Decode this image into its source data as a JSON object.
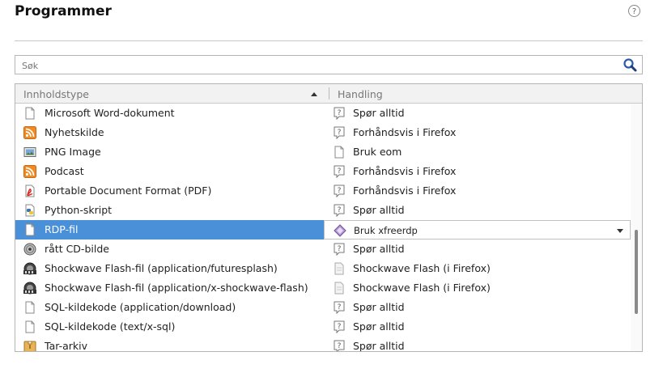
{
  "title": "Programmer",
  "help_glyph": "?",
  "search": {
    "placeholder": "Søk"
  },
  "table": {
    "col1": "Innholdstype",
    "col2": "Handling",
    "rows": [
      {
        "type": "Microsoft Word-dokument",
        "type_icon": "document-icon",
        "action": "Spør alltid",
        "action_icon": "ask-icon"
      },
      {
        "type": "Nyhetskilde",
        "type_icon": "rss-feed-icon",
        "action": "Forhåndsvis i Firefox",
        "action_icon": "ask-icon"
      },
      {
        "type": "PNG Image",
        "type_icon": "image-icon",
        "action": "Bruk eom",
        "action_icon": "document-icon"
      },
      {
        "type": "Podcast",
        "type_icon": "rss-feed-icon",
        "action": "Forhåndsvis i Firefox",
        "action_icon": "ask-icon"
      },
      {
        "type": "Portable Document Format (PDF)",
        "type_icon": "pdf-icon",
        "action": "Forhåndsvis i Firefox",
        "action_icon": "ask-icon"
      },
      {
        "type": "Python-skript",
        "type_icon": "python-icon",
        "action": "Spør alltid",
        "action_icon": "ask-icon"
      },
      {
        "type": "RDP-fil",
        "type_icon": "document-icon",
        "action": "Bruk xfreerdp",
        "action_icon": "xfreerdp-icon",
        "selected": true
      },
      {
        "type": "rått CD-bilde",
        "type_icon": "disc-icon",
        "action": "Spør alltid",
        "action_icon": "ask-icon"
      },
      {
        "type": "Shockwave Flash-fil (application/futuresplash)",
        "type_icon": "flash-film-icon",
        "action": "Shockwave Flash (i Firefox)",
        "action_icon": "plugin-icon"
      },
      {
        "type": "Shockwave Flash-fil (application/x-shockwave-flash)",
        "type_icon": "flash-film-icon",
        "action": "Shockwave Flash (i Firefox)",
        "action_icon": "plugin-icon"
      },
      {
        "type": "SQL-kildekode (application/download)",
        "type_icon": "document-icon",
        "action": "Spør alltid",
        "action_icon": "ask-icon"
      },
      {
        "type": "SQL-kildekode (text/x-sql)",
        "type_icon": "document-icon",
        "action": "Spør alltid",
        "action_icon": "ask-icon"
      },
      {
        "type": "Tar-arkiv",
        "type_icon": "archive-icon",
        "action": "Spør alltid",
        "action_icon": "ask-icon"
      }
    ]
  },
  "colors": {
    "selection": "#4a90d9",
    "rss": "#f08a24",
    "pdf": "#d9261c"
  }
}
